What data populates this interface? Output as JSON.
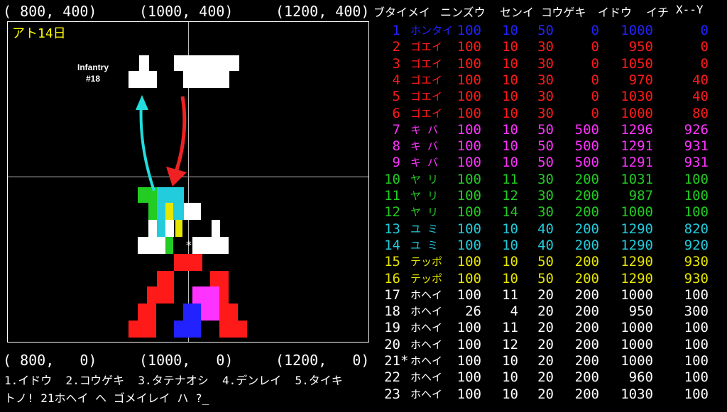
{
  "coords": {
    "top": [
      "( 800, 400)",
      "(1000, 400)",
      "(1200, 400)"
    ],
    "bottom": [
      "( 800,   0)",
      "(1000,   0)",
      "(1200,   0)"
    ]
  },
  "map": {
    "days_label": "アト14日",
    "unit_label": "Infantry\n#18",
    "cursor": "*"
  },
  "table": {
    "headers": [
      "ブタイメイ",
      "ニンズウ",
      "センイ",
      "コウゲキ",
      "イドウ",
      "イチ",
      "X--Y"
    ],
    "rows": [
      {
        "no": "1",
        "mark": "",
        "name": "ホンタイ",
        "men": "100",
        "morale": "10",
        "atk": "50",
        "move": "0",
        "x": "1000",
        "y": "0",
        "color": "#2222ff"
      },
      {
        "no": "2",
        "mark": "",
        "name": "ゴエイ",
        "men": "100",
        "morale": "10",
        "atk": "30",
        "move": "0",
        "x": "950",
        "y": "0",
        "color": "#ff1a1a"
      },
      {
        "no": "3",
        "mark": "",
        "name": "ゴエイ",
        "men": "100",
        "morale": "10",
        "atk": "30",
        "move": "0",
        "x": "1050",
        "y": "0",
        "color": "#ff1a1a"
      },
      {
        "no": "4",
        "mark": "",
        "name": "ゴエイ",
        "men": "100",
        "morale": "10",
        "atk": "30",
        "move": "0",
        "x": "970",
        "y": "40",
        "color": "#ff1a1a"
      },
      {
        "no": "5",
        "mark": "",
        "name": "ゴエイ",
        "men": "100",
        "morale": "10",
        "atk": "30",
        "move": "0",
        "x": "1030",
        "y": "40",
        "color": "#ff1a1a"
      },
      {
        "no": "6",
        "mark": "",
        "name": "ゴエイ",
        "men": "100",
        "morale": "10",
        "atk": "30",
        "move": "0",
        "x": "1000",
        "y": "80",
        "color": "#ff1a1a"
      },
      {
        "no": "7",
        "mark": "",
        "name": "キ バ",
        "men": "100",
        "morale": "10",
        "atk": "50",
        "move": "500",
        "x": "1296",
        "y": "926",
        "color": "#ff33ff"
      },
      {
        "no": "8",
        "mark": "",
        "name": "キ バ",
        "men": "100",
        "morale": "10",
        "atk": "50",
        "move": "500",
        "x": "1291",
        "y": "931",
        "color": "#ff33ff"
      },
      {
        "no": "9",
        "mark": "",
        "name": "キ バ",
        "men": "100",
        "morale": "10",
        "atk": "50",
        "move": "500",
        "x": "1291",
        "y": "931",
        "color": "#ff33ff"
      },
      {
        "no": "10",
        "mark": "",
        "name": "ヤ リ",
        "men": "100",
        "morale": "11",
        "atk": "30",
        "move": "200",
        "x": "1031",
        "y": "100",
        "color": "#22cc22"
      },
      {
        "no": "11",
        "mark": "",
        "name": "ヤ リ",
        "men": "100",
        "morale": "12",
        "atk": "30",
        "move": "200",
        "x": "987",
        "y": "100",
        "color": "#22cc22"
      },
      {
        "no": "12",
        "mark": "",
        "name": "ヤ リ",
        "men": "100",
        "morale": "14",
        "atk": "30",
        "move": "200",
        "x": "1000",
        "y": "100",
        "color": "#22cc22"
      },
      {
        "no": "13",
        "mark": "",
        "name": "ユ ミ",
        "men": "100",
        "morale": "10",
        "atk": "40",
        "move": "200",
        "x": "1290",
        "y": "820",
        "color": "#22ccdd"
      },
      {
        "no": "14",
        "mark": "",
        "name": "ユ ミ",
        "men": "100",
        "morale": "10",
        "atk": "40",
        "move": "200",
        "x": "1290",
        "y": "920",
        "color": "#22ccdd"
      },
      {
        "no": "15",
        "mark": "",
        "name": "テッポ",
        "men": "100",
        "morale": "10",
        "atk": "50",
        "move": "200",
        "x": "1290",
        "y": "930",
        "color": "#e6e600"
      },
      {
        "no": "16",
        "mark": "",
        "name": "テッポ",
        "men": "100",
        "morale": "10",
        "atk": "50",
        "move": "200",
        "x": "1290",
        "y": "930",
        "color": "#e6e600"
      },
      {
        "no": "17",
        "mark": "",
        "name": "ホヘイ",
        "men": "100",
        "morale": "11",
        "atk": "20",
        "move": "200",
        "x": "1000",
        "y": "100",
        "color": "#ffffff"
      },
      {
        "no": "18",
        "mark": "",
        "name": "ホヘイ",
        "men": "26",
        "morale": "4",
        "atk": "20",
        "move": "200",
        "x": "950",
        "y": "300",
        "color": "#ffffff"
      },
      {
        "no": "19",
        "mark": "",
        "name": "ホヘイ",
        "men": "100",
        "morale": "11",
        "atk": "20",
        "move": "200",
        "x": "1000",
        "y": "100",
        "color": "#ffffff"
      },
      {
        "no": "20",
        "mark": "",
        "name": "ホヘイ",
        "men": "100",
        "morale": "12",
        "atk": "20",
        "move": "200",
        "x": "1000",
        "y": "100",
        "color": "#ffffff"
      },
      {
        "no": "21",
        "mark": "*",
        "name": "ホヘイ",
        "men": "100",
        "morale": "10",
        "atk": "20",
        "move": "200",
        "x": "1000",
        "y": "100",
        "color": "#ffffff"
      },
      {
        "no": "22",
        "mark": "",
        "name": "ホヘイ",
        "men": "100",
        "morale": "10",
        "atk": "20",
        "move": "200",
        "x": "960",
        "y": "100",
        "color": "#ffffff"
      },
      {
        "no": "23",
        "mark": "",
        "name": "ホヘイ",
        "men": "100",
        "morale": "10",
        "atk": "20",
        "move": "200",
        "x": "1030",
        "y": "100",
        "color": "#ffffff"
      }
    ]
  },
  "commands": {
    "menu": "1.イドウ  2.コウゲキ  3.タテナオシ  4.デンレイ  5.タイキ",
    "prompt": "トノ! 21ホヘイ ヘ ゴメイレイ ハ ?_"
  },
  "colors": {
    "background": "#000000",
    "grid": "#bbbbbb",
    "days": "#ffff00",
    "cyan_arrow": "#22dddd",
    "red_arrow": "#ee2222"
  }
}
